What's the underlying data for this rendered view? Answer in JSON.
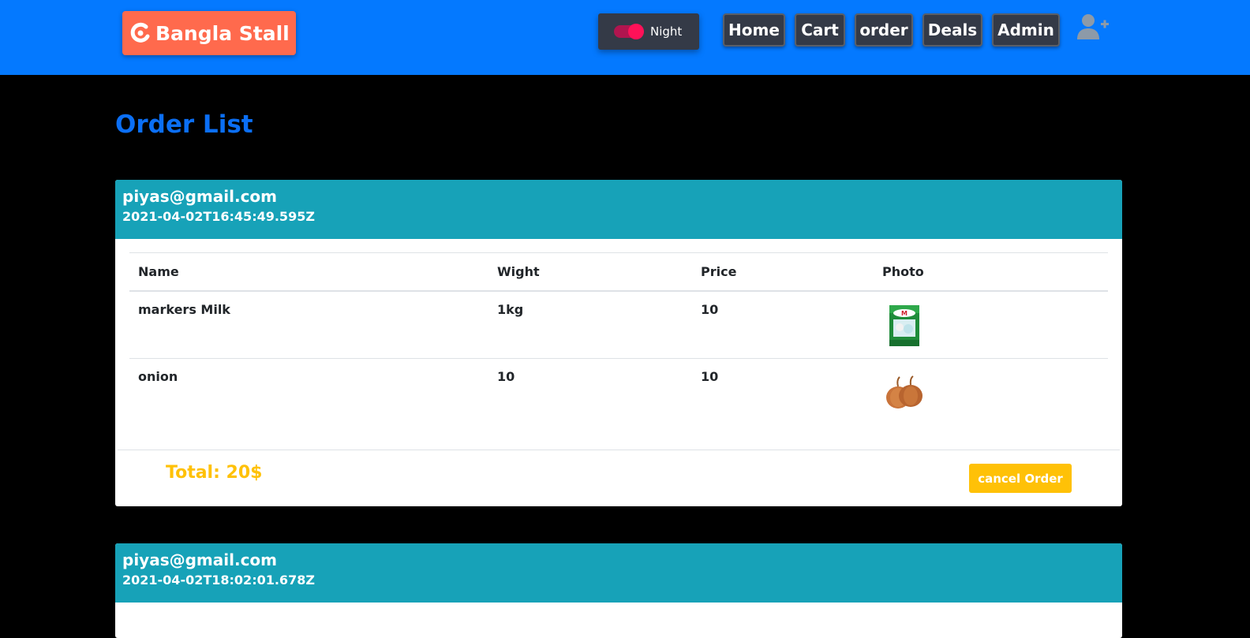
{
  "header": {
    "brand": "Bangla Stall",
    "night_label": "Night",
    "nav": [
      "Home",
      "Cart",
      "order",
      "Deals",
      "Admin"
    ]
  },
  "colors": {
    "navbar": "#0479ff",
    "brand_bg": "#ff6a4d",
    "card_header": "#17a2b8",
    "accent_yellow": "#ffc107",
    "title_blue": "#0b6ff5"
  },
  "page": {
    "title": "Order List"
  },
  "orders": [
    {
      "email": "piyas@gmail.com",
      "date": "2021-04-02T16:45:49.595Z",
      "columns": [
        "Name",
        "Wight",
        "Price",
        "Photo"
      ],
      "items": [
        {
          "name": "markers Milk",
          "wight": "1kg",
          "price": "10",
          "photo": "milk-packet-icon"
        },
        {
          "name": "onion",
          "wight": "10",
          "price": "10",
          "photo": "onion-icon"
        }
      ],
      "total": "Total: 20$",
      "cancel_label": "cancel Order"
    },
    {
      "email": "piyas@gmail.com",
      "date": "2021-04-02T18:02:01.678Z"
    }
  ]
}
